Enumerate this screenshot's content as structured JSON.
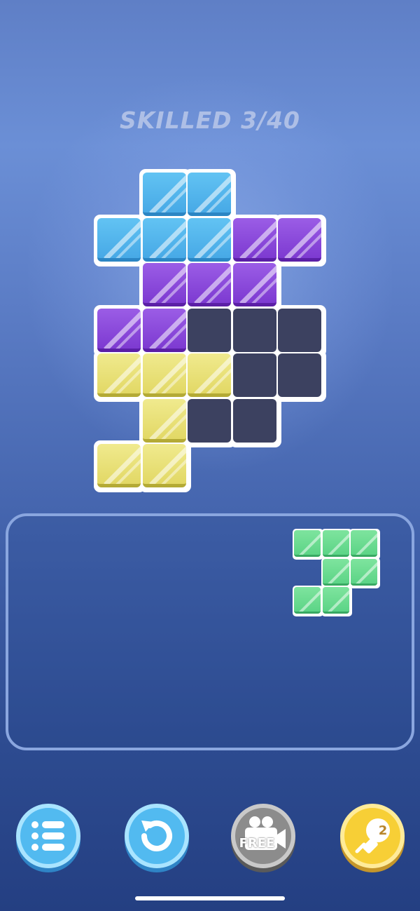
{
  "level": {
    "title": "SKILLED 3/40"
  },
  "board": {
    "cells": [
      {
        "r": 0,
        "c": 1,
        "color": "blue"
      },
      {
        "r": 0,
        "c": 2,
        "color": "blue"
      },
      {
        "r": 1,
        "c": 0,
        "color": "blue"
      },
      {
        "r": 1,
        "c": 1,
        "color": "blue"
      },
      {
        "r": 1,
        "c": 2,
        "color": "blue"
      },
      {
        "r": 1,
        "c": 3,
        "color": "purple"
      },
      {
        "r": 1,
        "c": 4,
        "color": "purple"
      },
      {
        "r": 2,
        "c": 1,
        "color": "purple"
      },
      {
        "r": 2,
        "c": 2,
        "color": "purple"
      },
      {
        "r": 2,
        "c": 3,
        "color": "purple"
      },
      {
        "r": 3,
        "c": 0,
        "color": "purple"
      },
      {
        "r": 3,
        "c": 1,
        "color": "purple"
      },
      {
        "r": 3,
        "c": 2,
        "color": "empty"
      },
      {
        "r": 3,
        "c": 3,
        "color": "empty"
      },
      {
        "r": 3,
        "c": 4,
        "color": "empty"
      },
      {
        "r": 4,
        "c": 0,
        "color": "yellow"
      },
      {
        "r": 4,
        "c": 1,
        "color": "yellow"
      },
      {
        "r": 4,
        "c": 2,
        "color": "yellow"
      },
      {
        "r": 4,
        "c": 3,
        "color": "empty"
      },
      {
        "r": 4,
        "c": 4,
        "color": "empty"
      },
      {
        "r": 5,
        "c": 1,
        "color": "yellow"
      },
      {
        "r": 5,
        "c": 2,
        "color": "empty"
      },
      {
        "r": 5,
        "c": 3,
        "color": "empty"
      },
      {
        "r": 6,
        "c": 0,
        "color": "yellow"
      },
      {
        "r": 6,
        "c": 1,
        "color": "yellow"
      }
    ]
  },
  "tray": {
    "pieces": [
      {
        "color": "green",
        "cells": [
          {
            "r": 0,
            "c": 0
          },
          {
            "r": 0,
            "c": 1
          },
          {
            "r": 0,
            "c": 2
          },
          {
            "r": 1,
            "c": 1
          },
          {
            "r": 1,
            "c": 2
          },
          {
            "r": 2,
            "c": 0
          },
          {
            "r": 2,
            "c": 1
          }
        ]
      }
    ]
  },
  "buttons": {
    "menu": {
      "icon": "list-icon"
    },
    "restart": {
      "icon": "restart-icon"
    },
    "video": {
      "icon": "video-camera-icon",
      "label": "FREE"
    },
    "hint": {
      "icon": "lightbulb-icon",
      "count": "2"
    }
  },
  "colors": {
    "blue": "#47a9e6",
    "purple": "#7d3ad1",
    "yellow": "#e2d865",
    "green": "#5cd486",
    "empty": "#3c4160"
  }
}
